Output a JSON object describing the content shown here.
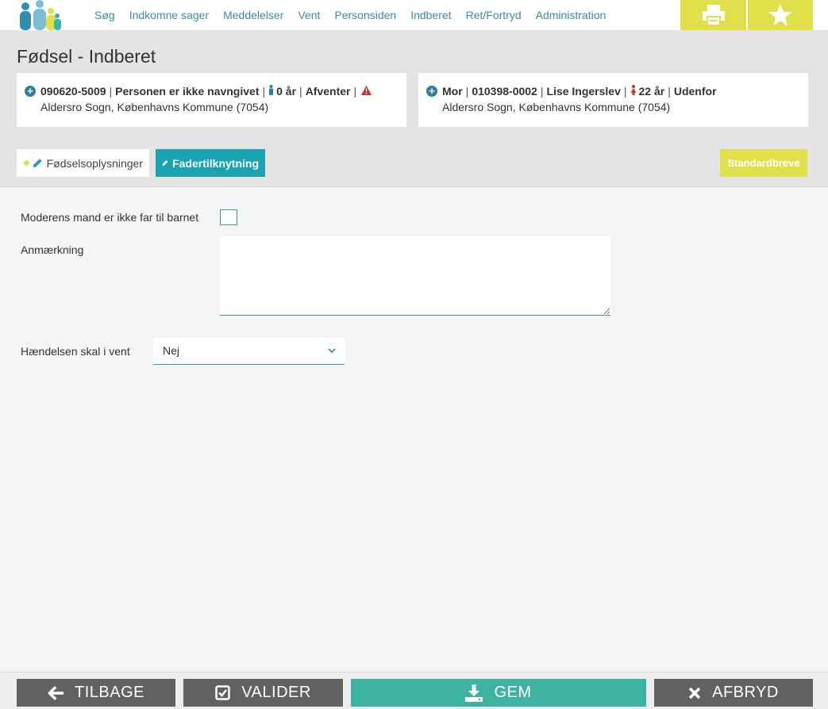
{
  "nav": {
    "items": [
      "Søg",
      "Indkomne sager",
      "Meddelelser",
      "Vent",
      "Personsiden",
      "Indberet",
      "Ret/Fortryd",
      "Administration"
    ]
  },
  "header": {
    "title": "Fødsel - Indberet"
  },
  "child_card": {
    "cpr": "090620-5009",
    "name": "Personen er ikke navngivet",
    "age": "0 år",
    "status": "Afventer",
    "address": "Aldersro Sogn, Københavns Kommune (7054)"
  },
  "mother_card": {
    "role": "Mor",
    "cpr": "010398-0002",
    "name": "Lise Ingerslev",
    "age": "22 år",
    "status": "Udenfor",
    "address": "Aldersro Sogn, Københavns Kommune (7054)"
  },
  "tabs": [
    {
      "label": "Fødselsoplysninger"
    },
    {
      "label": "Fadertilknytning"
    }
  ],
  "standard_letters_label": "Standardbreve",
  "form": {
    "not_father_label": "Moderens mand er ikke far til barnet",
    "remark_label": "Anmærkning",
    "remark_value": "",
    "hold_label": "Hændelsen skal i vent",
    "hold_value": "Nej"
  },
  "footer": {
    "back": "TILBAGE",
    "validate": "VALIDER",
    "save": "GEM",
    "cancel": "AFBRYD"
  },
  "colors": {
    "nav_link": "#3a8fa6",
    "accent_yellow": "#dfe04a",
    "active_tab": "#1aa3b0",
    "save_green": "#3db3a1",
    "footer_grey": "#616161",
    "warning_red": "#c0392b"
  }
}
